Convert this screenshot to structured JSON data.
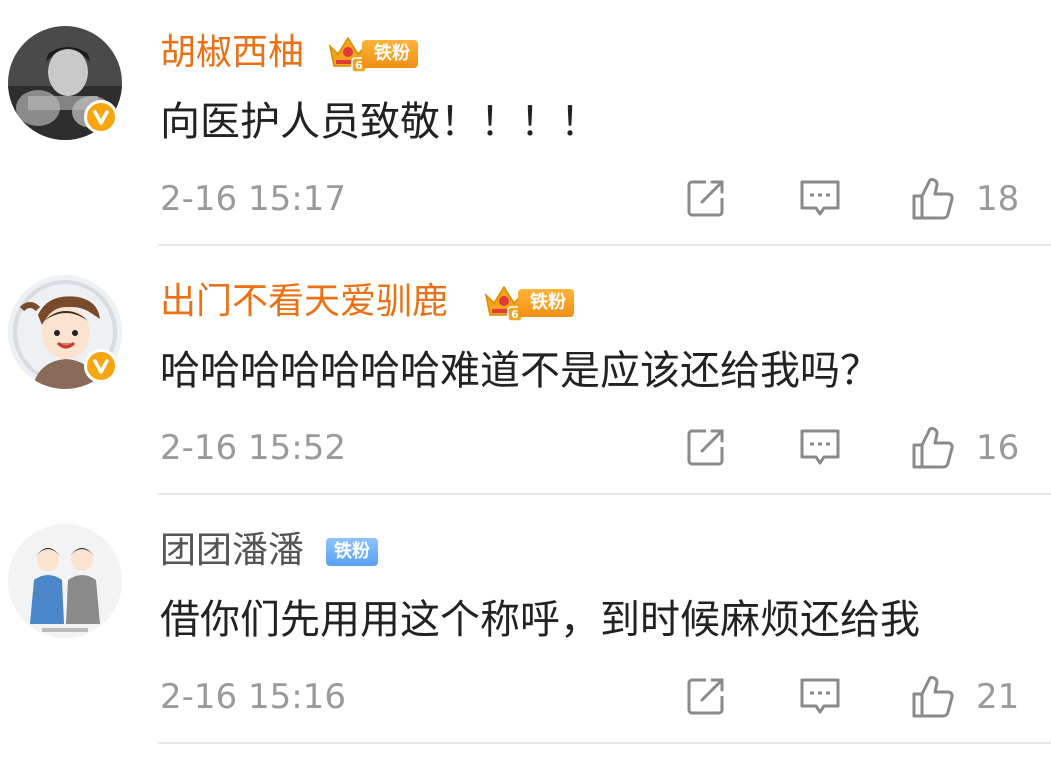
{
  "comments": [
    {
      "username": "胡椒西柚",
      "fan_badge": "铁粉",
      "crown_level": "6",
      "text": "向医护人员致敬！！！！",
      "time": "2-16 15:17",
      "likes": "18"
    },
    {
      "username": "出门不看天爱驯鹿",
      "fan_badge": "铁粉",
      "crown_level": "6",
      "text": "哈哈哈哈哈哈哈难道不是应该还给我吗？",
      "time": "2-16 15:52",
      "likes": "16"
    },
    {
      "username": "团团潘潘",
      "fan_badge": "铁粉",
      "text": "借你们先用用这个称呼，到时候麻烦还给我",
      "time": "2-16 15:16",
      "likes": "21"
    }
  ],
  "icons": {
    "share": "share-icon",
    "comment": "comment-icon",
    "like": "thumbs-up-icon",
    "verified": "verified-badge-icon",
    "crown": "crown-icon"
  },
  "colors": {
    "vip_username": "#eb7114",
    "normal_username": "#555555",
    "verified": "#f7a60f",
    "meta_gray": "#9a9a9a",
    "text": "#222222",
    "fan_badge_gold": "#f5a020",
    "fan_badge_blue": "#6aaaf5"
  }
}
